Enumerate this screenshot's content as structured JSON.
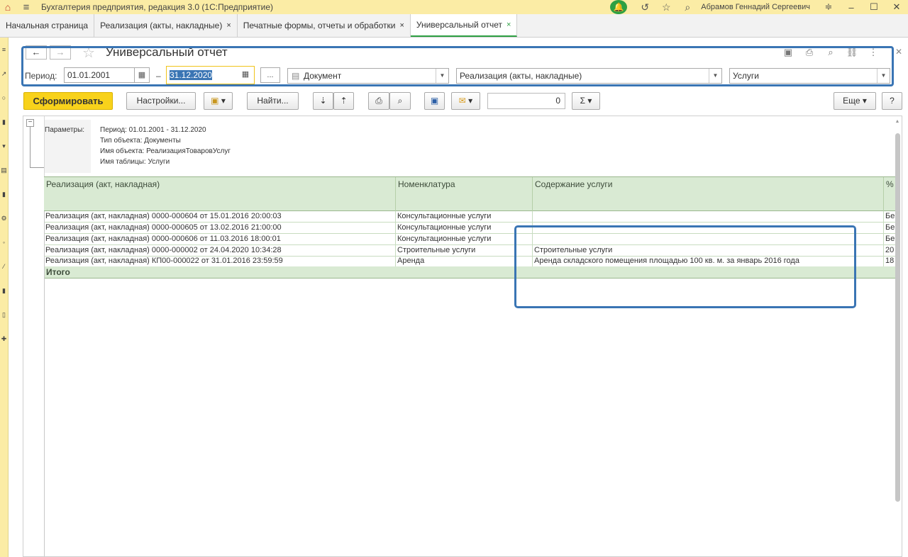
{
  "app": {
    "title": "Бухгалтерия предприятия, редакция 3.0  (1С:Предприятие)",
    "user": "Абрамов Геннадий Сергеевич"
  },
  "tabs": [
    {
      "label": "Начальная страница",
      "closable": false
    },
    {
      "label": "Реализация (акты, накладные)",
      "closable": true
    },
    {
      "label": "Печатные формы, отчеты и обработки",
      "closable": true
    },
    {
      "label": "Универсальный отчет",
      "closable": true,
      "active": true
    }
  ],
  "tab_close_glyph": "×",
  "header": {
    "title": "Универсальный отчет",
    "back_glyph": "←",
    "forward_glyph": "→"
  },
  "filters": {
    "period_label": "Период:",
    "date_from": "01.01.2001",
    "dash": "–",
    "date_to": "31.12.2020",
    "ellipsis": "...",
    "object_type": "Документ",
    "object_name": "Реализация (акты, накладные)",
    "table_name": "Услуги"
  },
  "toolbar": {
    "generate": "Сформировать",
    "settings": "Настройки...",
    "find": "Найти...",
    "number_value": "0",
    "sigma": "Σ",
    "more": "Еще",
    "help": "?"
  },
  "params": {
    "label": "Параметры:",
    "lines": [
      "Период: 01.01.2001 - 31.12.2020",
      "Тип объекта: Документы",
      "Имя объекта: РеализацияТоваровУслуг",
      "Имя таблицы: Услуги"
    ]
  },
  "table": {
    "columns": [
      "Реализация (акт, накладная)",
      "Номенклатура",
      "Содержание услуги",
      "%"
    ],
    "rows": [
      [
        "Реализация (акт, накладная) 0000-000604 от 15.01.2016 20:00:03",
        "Консультационные услуги",
        "",
        "Бе"
      ],
      [
        "Реализация (акт, накладная) 0000-000605 от 13.02.2016 21:00:00",
        "Консультационные услуги",
        "",
        "Бе"
      ],
      [
        "Реализация (акт, накладная) 0000-000606 от 11.03.2016 18:00:01",
        "Консультационные услуги",
        "",
        "Бе"
      ],
      [
        "Реализация (акт, накладная) 0000-000002 от 24.04.2020 10:34:28",
        "Строительные услуги",
        "Строительные услуги",
        "20"
      ],
      [
        "Реализация (акт, накладная) КП00-000022 от 31.01.2016 23:59:59",
        "Аренда",
        "Аренда складского помещения площадью 100 кв. м. за январь 2016 года",
        "18"
      ]
    ],
    "total_label": "Итого"
  },
  "colors": {
    "title_bar": "#fbeca5",
    "accent_green": "#2ea043",
    "primary_button": "#f8d21b",
    "table_header": "#d9ead3",
    "highlight": "#3a75b4"
  }
}
